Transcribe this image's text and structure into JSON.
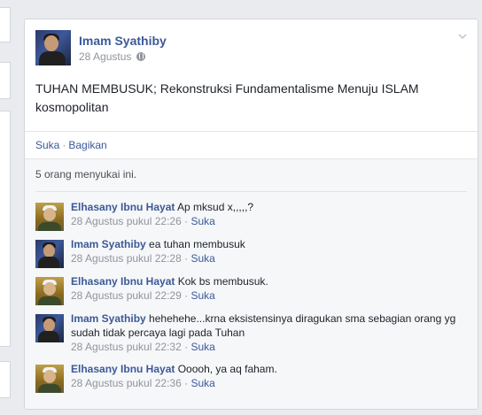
{
  "post": {
    "author": "Imam Syathiby",
    "date": "28 Agustus",
    "text": "TUHAN MEMBUSUK; Rekonstruksi Fundamentalisme Menuju ISLAM kosmopolitan",
    "actions": {
      "like": "Suka",
      "separator": "·",
      "share": "Bagikan"
    },
    "likes_summary": "5 orang menyukai ini."
  },
  "comments": [
    {
      "author": "Elhasany Ibnu Hayat",
      "text": "Ap mksud x,,,,,?",
      "timestamp": "28 Agustus pukul 22:26",
      "like": "Suka",
      "avatar": "elhasany"
    },
    {
      "author": "Imam Syathiby",
      "text": "ea tuhan membusuk",
      "timestamp": "28 Agustus pukul 22:28",
      "like": "Suka",
      "avatar": "imam"
    },
    {
      "author": "Elhasany Ibnu Hayat",
      "text": "Kok bs membusuk.",
      "timestamp": "28 Agustus pukul 22:29",
      "like": "Suka",
      "avatar": "elhasany"
    },
    {
      "author": "Imam Syathiby",
      "text": "hehehehe...krna eksistensinya diragukan sma sebagian orang yg sudah tidak percaya lagi pada Tuhan",
      "timestamp": "28 Agustus pukul 22:32",
      "like": "Suka",
      "avatar": "imam"
    },
    {
      "author": "Elhasany Ibnu Hayat",
      "text": "Ooooh, ya aq faham.",
      "timestamp": "28 Agustus pukul 22:36",
      "like": "Suka",
      "avatar": "elhasany"
    }
  ],
  "colors": {
    "link": "#3b5998",
    "meta": "#90949c",
    "background": "#e9ebee"
  }
}
